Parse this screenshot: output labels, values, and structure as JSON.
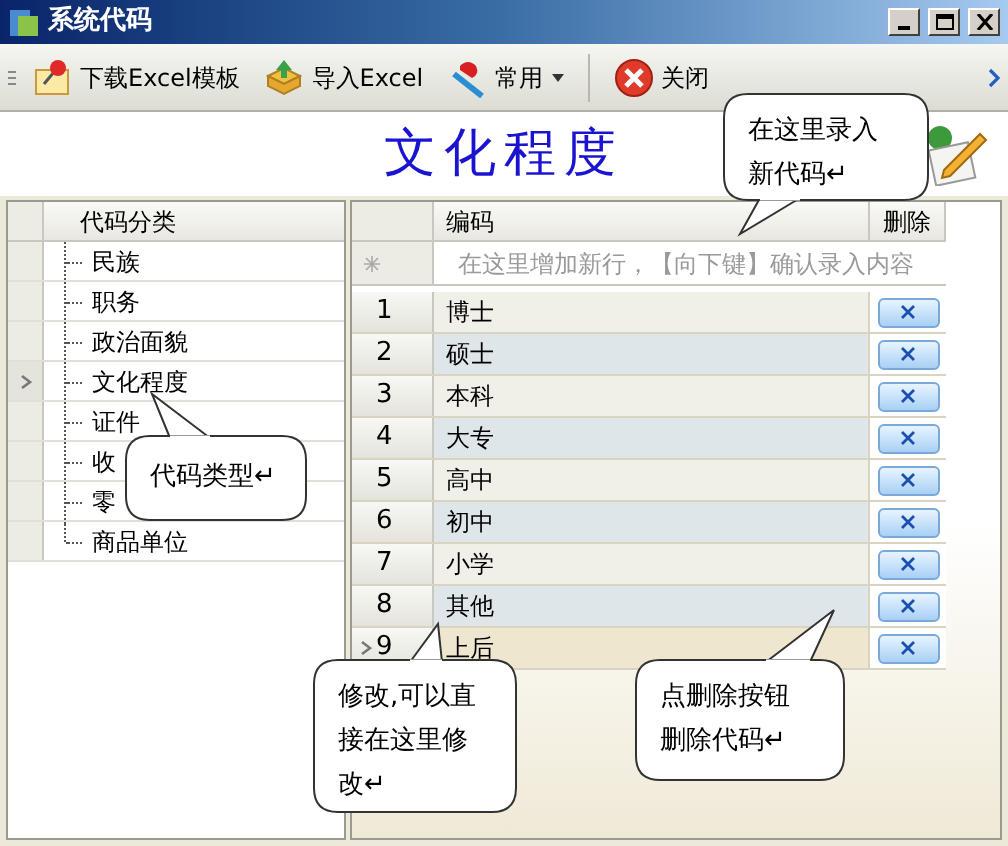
{
  "window": {
    "title": "系统代码"
  },
  "toolbar": [
    {
      "label": "下载Excel模板",
      "kind": "button"
    },
    {
      "label": "导入Excel",
      "kind": "button"
    },
    {
      "label": "常用",
      "kind": "dropdown"
    },
    {
      "label": "关闭",
      "kind": "button"
    }
  ],
  "heading": "文化程度",
  "category_grid": {
    "column": "代码分类",
    "items": [
      {
        "label": "民族",
        "selected": false
      },
      {
        "label": "职务",
        "selected": false
      },
      {
        "label": "政治面貌",
        "selected": false
      },
      {
        "label": "文化程度",
        "selected": true
      },
      {
        "label": "证件",
        "selected": false
      },
      {
        "label": "收",
        "selected": false
      },
      {
        "label": "零",
        "selected": false
      },
      {
        "label": "商品单位",
        "selected": false
      }
    ]
  },
  "code_grid": {
    "columns": [
      "编码",
      "删除"
    ],
    "new_row_placeholder": "在这里增加新行，【向下键】确认录入内容",
    "rows": [
      {
        "number": "1",
        "value": "博士",
        "current": false
      },
      {
        "number": "2",
        "value": "硕士",
        "current": false
      },
      {
        "number": "3",
        "value": "本科",
        "current": false
      },
      {
        "number": "4",
        "value": "大专",
        "current": false
      },
      {
        "number": "5",
        "value": "高中",
        "current": false
      },
      {
        "number": "6",
        "value": "初中",
        "current": false
      },
      {
        "number": "7",
        "value": "小学",
        "current": false
      },
      {
        "number": "8",
        "value": "其他",
        "current": false
      },
      {
        "number": "9",
        "value": "上后",
        "current": true
      }
    ]
  },
  "callouts": [
    {
      "text": "在这里录入新代码↵"
    },
    {
      "text": "代码类型↵"
    },
    {
      "text": "修改,可以直接在这里修改↵"
    },
    {
      "text": "点删除按钮删除代码↵"
    }
  ]
}
